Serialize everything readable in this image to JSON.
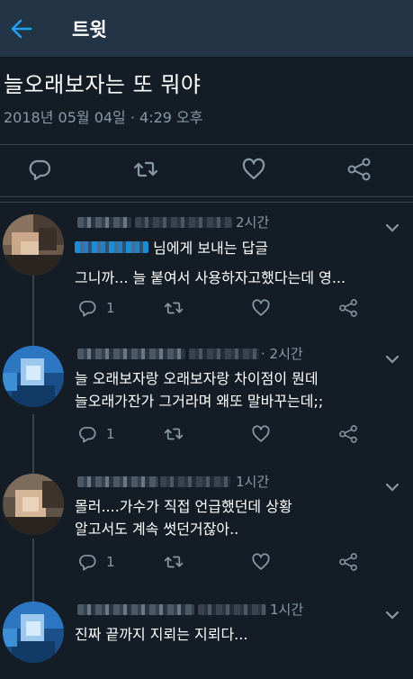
{
  "header": {
    "title": "트윗",
    "back_icon": "back-arrow-icon"
  },
  "tweet": {
    "text": "늘오래보자는 또 뭐야",
    "timestamp": "2018년 05월 04일 · 4:29 오후",
    "actions": [
      "reply-icon",
      "retweet-icon",
      "like-icon",
      "share-icon"
    ]
  },
  "replies": [
    {
      "time": "2시간",
      "replying_suffix": "님에게 보내는 답글",
      "lines": [
        "그니까... 늘 붙여서 사용하자고했다는데 영..."
      ],
      "reply_count": "1"
    },
    {
      "time": "· 2시간",
      "lines": [
        "늘 오래보자랑 오래보자랑 차이점이 뭔데",
        "늘오래가잔가 그거라며 왜또 말바꾸는데;;"
      ],
      "reply_count": "1"
    },
    {
      "time": "1시간",
      "lines": [
        "몰러....가수가 직접 언급했던데 상황",
        "알고서도 계속 썻던거잖아.."
      ],
      "reply_count": "1"
    },
    {
      "time": "1시간",
      "lines": [
        "진짜 끝까지 지뢰는 지뢰다..."
      ]
    }
  ],
  "colors": {
    "background": "#141d26",
    "header_bg": "#243447",
    "accent": "#1da1f2",
    "secondary_text": "#8899a6",
    "divider": "#38444d"
  }
}
